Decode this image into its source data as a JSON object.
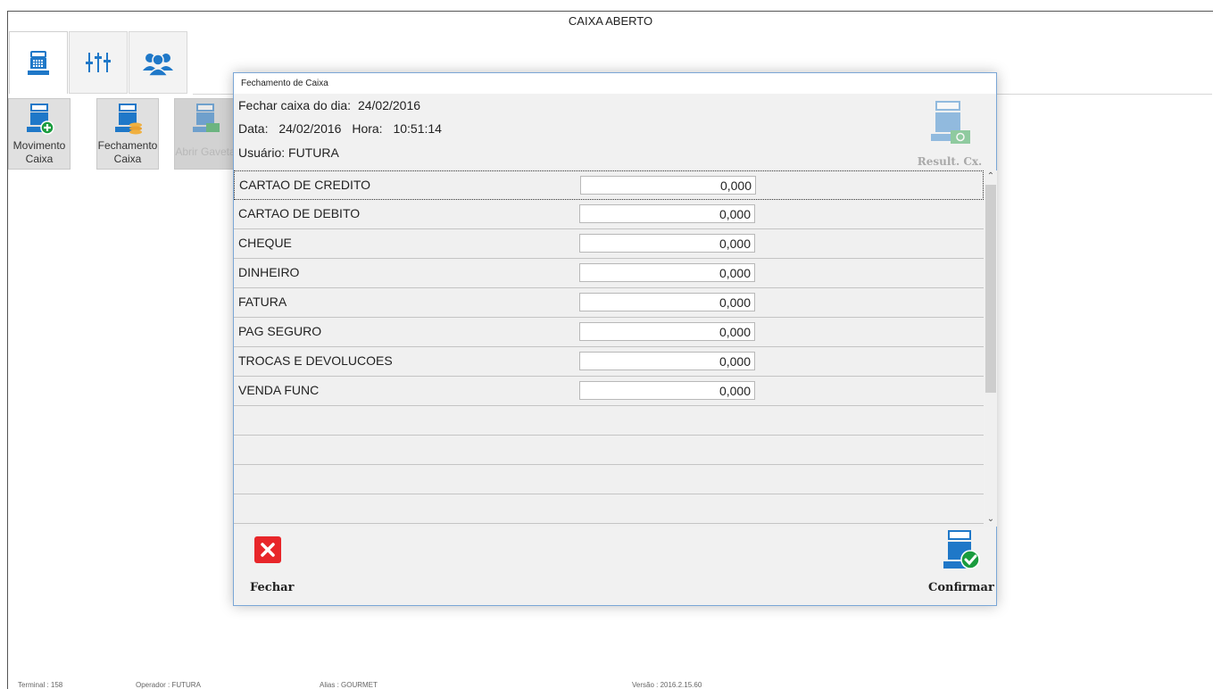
{
  "window": {
    "title": "CAIXA ABERTO"
  },
  "tabs": [
    {
      "icon": "cash-register-icon",
      "active": true
    },
    {
      "icon": "sliders-icon",
      "active": false
    },
    {
      "icon": "users-icon",
      "active": false
    }
  ],
  "toolbar": {
    "movimento": {
      "line1": "Movimento",
      "line2": "Caixa"
    },
    "fechamento": {
      "line1": "Fechamento",
      "line2": "Caixa"
    },
    "abrir_gaveta": {
      "label": "Abrir Gaveta"
    }
  },
  "dialog": {
    "title": "Fechamento de Caixa",
    "fechar_caixa_label": "Fechar caixa do dia:",
    "fechar_caixa_date": "24/02/2016",
    "data_label": "Data:",
    "data_value": "24/02/2016",
    "hora_label": "Hora:",
    "hora_value": "10:51:14",
    "usuario": "Usuário: FUTURA",
    "result_label": "Result. Cx.",
    "payments": [
      {
        "name": "CARTAO DE CREDITO",
        "value": "0,000"
      },
      {
        "name": "CARTAO DE DEBITO",
        "value": "0,000"
      },
      {
        "name": "CHEQUE",
        "value": "0,000"
      },
      {
        "name": "DINHEIRO",
        "value": "0,000"
      },
      {
        "name": "FATURA",
        "value": "0,000"
      },
      {
        "name": "PAG SEGURO",
        "value": "0,000"
      },
      {
        "name": "TROCAS E DEVOLUCOES",
        "value": "0,000"
      },
      {
        "name": "VENDA FUNC",
        "value": "0,000"
      }
    ],
    "fechar_label": "Fechar",
    "confirmar_label": "Confirmar"
  },
  "status": {
    "terminal": "Terminal : 158",
    "operador": "Operador : FUTURA",
    "alias": "Alias : GOURMET",
    "versao": "Versão : 2016.2.15.60"
  },
  "colors": {
    "accent": "#1f78c8",
    "close_red": "#e8262a",
    "ok_green": "#1a9c3e"
  }
}
